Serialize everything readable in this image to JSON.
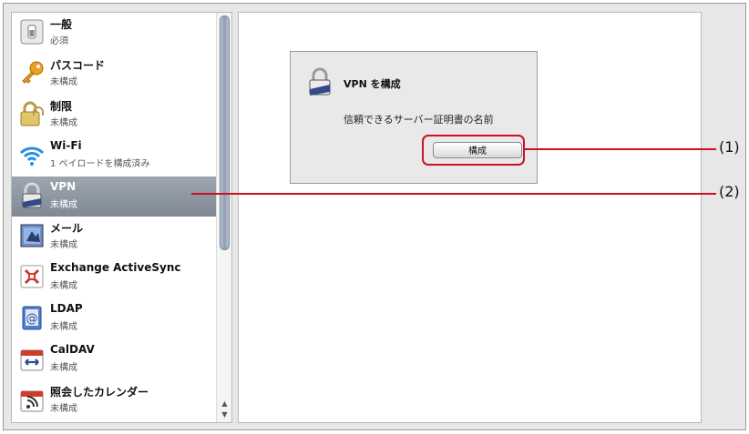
{
  "sidebar": {
    "items": [
      {
        "title": "一般",
        "subtitle": "必須",
        "icon": "switch-icon"
      },
      {
        "title": "パスコード",
        "subtitle": "未構成",
        "icon": "key-icon"
      },
      {
        "title": "制限",
        "subtitle": "未構成",
        "icon": "padlock-icon"
      },
      {
        "title": "Wi-Fi",
        "subtitle": "1 ペイロードを構成済み",
        "icon": "wifi-icon"
      },
      {
        "title": "VPN",
        "subtitle": "未構成",
        "icon": "vpn-lock-icon"
      },
      {
        "title": "メール",
        "subtitle": "未構成",
        "icon": "mail-stamp-icon"
      },
      {
        "title": "Exchange ActiveSync",
        "subtitle": "未構成",
        "icon": "exchange-icon"
      },
      {
        "title": "LDAP",
        "subtitle": "未構成",
        "icon": "at-sign-book-icon"
      },
      {
        "title": "CalDAV",
        "subtitle": "未構成",
        "icon": "calendar-sync-icon"
      },
      {
        "title": "照会したカレンダー",
        "subtitle": "未構成",
        "icon": "calendar-rss-icon"
      }
    ],
    "selected_index": 4
  },
  "vpn_panel": {
    "heading": "VPN を構成",
    "description": "信頼できるサーバー証明書の名前",
    "configure_button": "構成"
  },
  "callouts": {
    "one": "(1)",
    "two": "(2)"
  },
  "colors": {
    "callout_red": "#cc1122",
    "selected_bg": "#8a939e"
  }
}
